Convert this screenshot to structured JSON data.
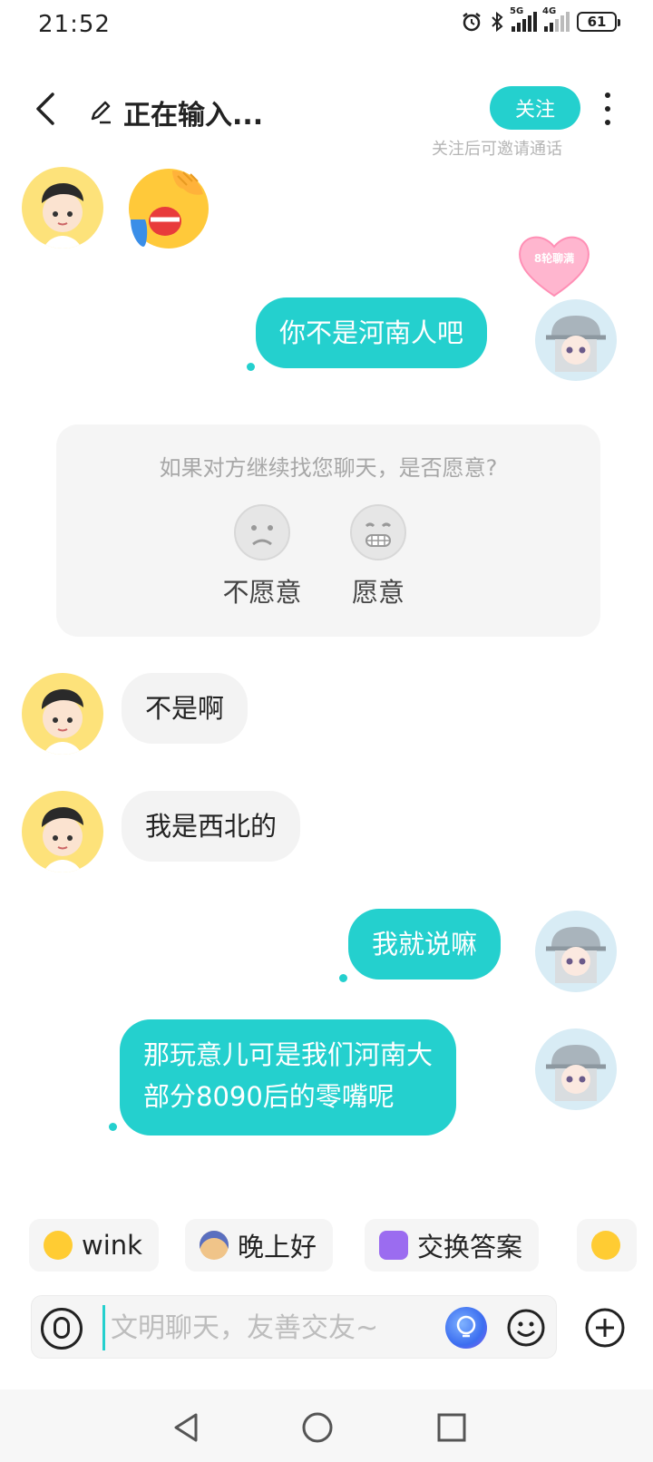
{
  "status_bar": {
    "time": "21:52",
    "network_1": "5G",
    "network_2": "4G",
    "battery": "61"
  },
  "header": {
    "title": "正在输入...",
    "follow_label": "关注",
    "follow_hint": "关注后可邀请通话"
  },
  "chat": {
    "badge": "8轮聊满",
    "messages": [
      {
        "side": "in",
        "type": "emoji",
        "emoji": "loudly-crying-face"
      },
      {
        "side": "out",
        "text": "你不是河南人吧"
      },
      {
        "side": "in",
        "text": "不是啊"
      },
      {
        "side": "in",
        "text": "我是西北的"
      },
      {
        "side": "out",
        "text": "我就说嘛"
      },
      {
        "side": "out",
        "text_lines": [
          "那玩意儿可是我们河南大",
          "部分8090后的零嘴呢"
        ]
      }
    ]
  },
  "survey": {
    "question": "如果对方继续找您聊天，是否愿意?",
    "options": [
      {
        "label": "不愿意",
        "icon": "sad-face-icon"
      },
      {
        "label": "愿意",
        "icon": "grin-face-icon"
      }
    ]
  },
  "quick_replies": [
    {
      "label": "wink",
      "icon": "wink-emoji"
    },
    {
      "label": "晚上好",
      "icon": "moon-face-emoji"
    },
    {
      "label": "交换答案",
      "icon": "swap-answer-icon"
    },
    {
      "label": "",
      "icon": "wink-emoji"
    }
  ],
  "input": {
    "placeholder": "文明聊天，友善交友~"
  },
  "colors": {
    "accent": "#24d0ce",
    "bubble_in": "#f3f3f3",
    "card_bg": "#f5f5f5"
  }
}
